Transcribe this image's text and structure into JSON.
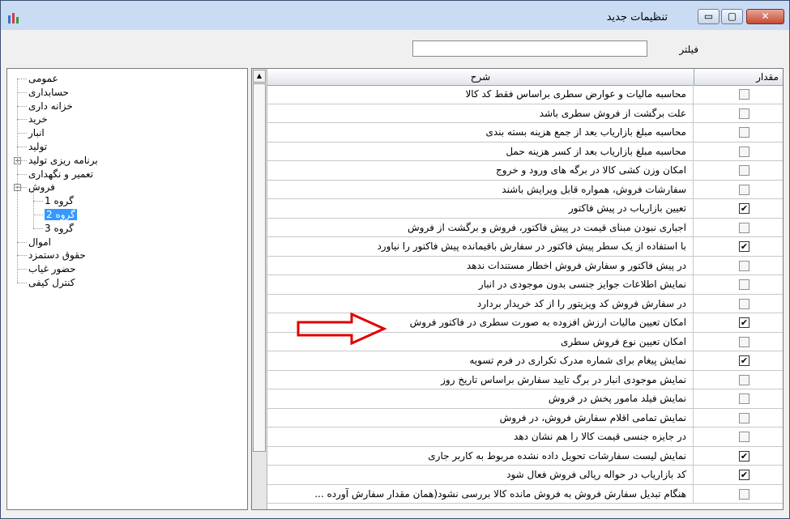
{
  "window": {
    "title": "تنظیمات جدید",
    "controls": {
      "minimize": "▭",
      "maximize": "▢",
      "close": "✕"
    }
  },
  "filter": {
    "label": "فیلتر",
    "value": ""
  },
  "tree": {
    "items": [
      {
        "label": "عمومی"
      },
      {
        "label": "حسابداری"
      },
      {
        "label": "خزانه داری"
      },
      {
        "label": "خرید"
      },
      {
        "label": "انبار"
      },
      {
        "label": "تولید"
      },
      {
        "label": "برنامه ریزی تولید",
        "expander": "+"
      },
      {
        "label": "تعمیر و نگهداری"
      },
      {
        "label": "فروش",
        "expander": "−"
      },
      {
        "label": "گروه 1"
      },
      {
        "label": "گروه 2",
        "selected": true
      },
      {
        "label": "گروه 3"
      },
      {
        "label": "اموال"
      },
      {
        "label": "حقوق دستمزد"
      },
      {
        "label": "حضور غیاب"
      },
      {
        "label": "کنترل کیفی"
      }
    ]
  },
  "grid": {
    "columns": {
      "description": "شرح",
      "value": "مقدار"
    },
    "rows": [
      {
        "text": "محاسبه مالیات و عوارض سطری براساس فقط کد کالا",
        "checked": false
      },
      {
        "text": "علت برگشت از فروش سطری باشد",
        "checked": false
      },
      {
        "text": "محاسبه مبلغ بازاریاب بعد از جمع هزینه بسته بندی",
        "checked": false
      },
      {
        "text": "محاسبه مبلغ بازاریاب بعد از کسر هزینه حمل",
        "checked": false
      },
      {
        "text": "امکان وزن کشی کالا در برگه های ورود و خروج",
        "checked": false
      },
      {
        "text": "سفارشات فروش، همواره قابل ویرایش باشند",
        "checked": false
      },
      {
        "text": "تعیین بازاریاب در پیش فاکتور",
        "checked": true
      },
      {
        "text": "اجباری نبودن مبنای قیمت در پیش فاکتور، فروش و برگشت از فروش",
        "checked": false
      },
      {
        "text": "با استفاده از یک سطر پیش فاکتور در سفارش باقیمانده پیش فاکتور را نیاورد",
        "checked": true
      },
      {
        "text": "در پیش فاکتور و سفارش فروش اخطار مستندات ندهد",
        "checked": false
      },
      {
        "text": "نمایش اطلاعات جوایز جنسی بدون موجودی در انبار",
        "checked": false
      },
      {
        "text": "در سفارش فروش کد ویزیتور را از کد خریدار بردارد",
        "checked": false
      },
      {
        "text": "امکان تعیین مالیات ارزش افزوده به صورت سطری در فاکتور فروش",
        "checked": true
      },
      {
        "text": "امکان تعیین نوع فروش سطری",
        "checked": false
      },
      {
        "text": "نمایش پیغام برای شماره مدرک تکراری در فرم تسویه",
        "checked": true
      },
      {
        "text": "نمایش موجودی انبار در برگ تایید سفارش براساس تاریخ روز",
        "checked": false
      },
      {
        "text": "نمایش فیلد مامور پخش در فروش",
        "checked": false
      },
      {
        "text": "نمایش تمامی اقلام سفارش فروش، در فروش",
        "checked": false
      },
      {
        "text": "در جایزه جنسی قیمت کالا را هم نشان دهد",
        "checked": false
      },
      {
        "text": "نمایش لیست سفارشات تحویل داده نشده مربوط به کاربر جاری",
        "checked": true
      },
      {
        "text": "کد بازاریاب در حواله ریالی فروش فعال شود",
        "checked": true
      },
      {
        "text": "هنگام تبدیل سفارش فروش به فروش مانده کالا بررسی نشود(همان مقدار سفارش آورده ...",
        "checked": false
      }
    ]
  },
  "colors": {
    "titlebar": "#c9dcf3",
    "selection": "#3399ff",
    "arrow": "#e00000"
  },
  "scrollbar": {
    "up_arrow": "▲"
  }
}
